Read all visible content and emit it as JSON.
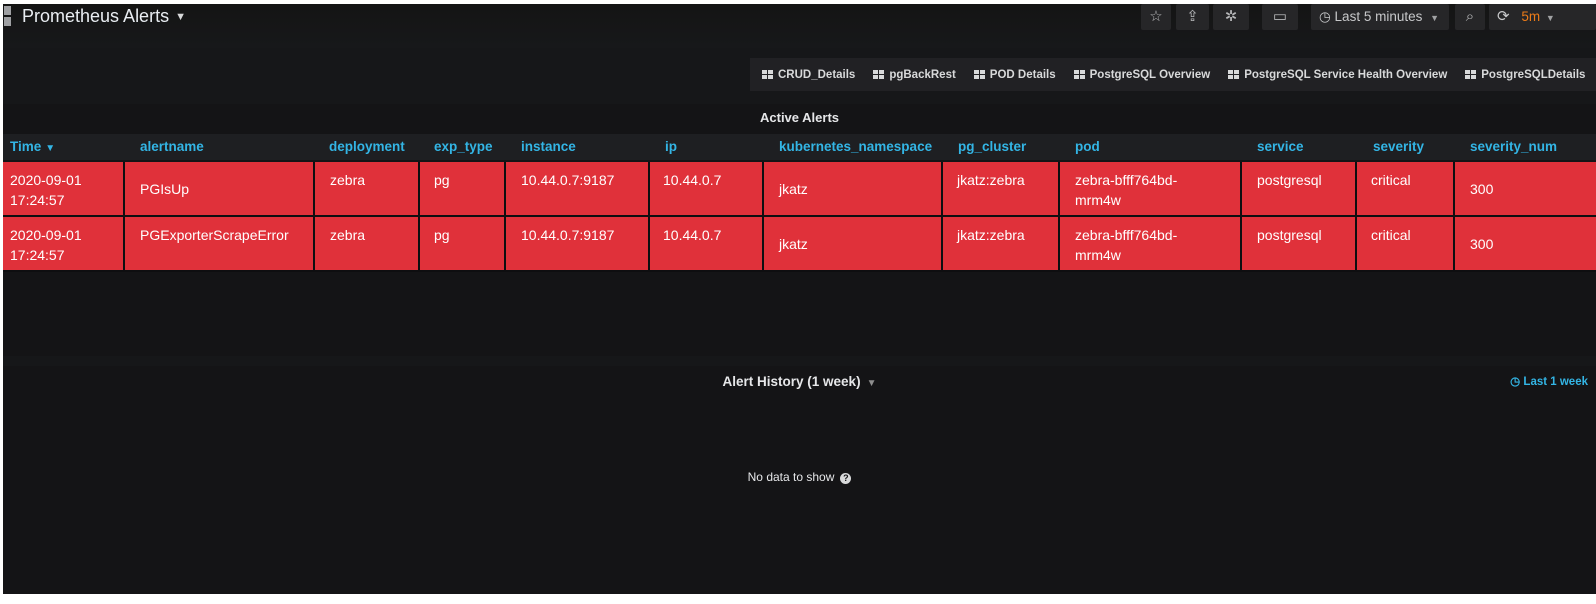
{
  "navbar": {
    "title": "Prometheus Alerts",
    "star_icon": "☆",
    "share_icon": "⇪",
    "settings_icon": "✲",
    "tv_icon": "▭",
    "time_picker_label": "Last 5 minutes",
    "zoom_icon": "⌕",
    "refresh_icon": "⟳",
    "refresh_interval": "5m"
  },
  "dashboard_links": [
    "CRUD_Details",
    "pgBackRest",
    "POD Details",
    "PostgreSQL Overview",
    "PostgreSQL Service Health Overview",
    "PostgreSQLDetails"
  ],
  "active_alerts": {
    "title": "Active Alerts",
    "columns": [
      "Time",
      "alertname",
      "deployment",
      "exp_type",
      "instance",
      "ip",
      "kubernetes_namespace",
      "pg_cluster",
      "pod",
      "service",
      "severity",
      "severity_num"
    ],
    "rows": [
      {
        "time_date": "2020-09-01",
        "time_clock": "17:24:57",
        "alertname": "PGIsUp",
        "deployment": "zebra",
        "exp_type": "pg",
        "instance": "10.44.0.7:9187",
        "ip": "10.44.0.7",
        "kubernetes_namespace": "jkatz",
        "pg_cluster": "jkatz:zebra",
        "pod_line1": "zebra-bfff764bd-",
        "pod_line2": "mrm4w",
        "service": "postgresql",
        "severity": "critical",
        "severity_num": "300"
      },
      {
        "time_date": "2020-09-01",
        "time_clock": "17:24:57",
        "alertname": "PGExporterScrapeError",
        "deployment": "zebra",
        "exp_type": "pg",
        "instance": "10.44.0.7:9187",
        "ip": "10.44.0.7",
        "kubernetes_namespace": "jkatz",
        "pg_cluster": "jkatz:zebra",
        "pod_line1": "zebra-bfff764bd-",
        "pod_line2": "mrm4w",
        "service": "postgresql",
        "severity": "critical",
        "severity_num": "300"
      }
    ]
  },
  "alert_history": {
    "title": "Alert History (1 week)",
    "time_override": "Last 1 week",
    "no_data_text": "No data to show"
  },
  "colors": {
    "alert_cell": "#e0313a",
    "header_text": "#33b5e5",
    "refresh_accent": "#eb7b18",
    "background": "#161719"
  }
}
